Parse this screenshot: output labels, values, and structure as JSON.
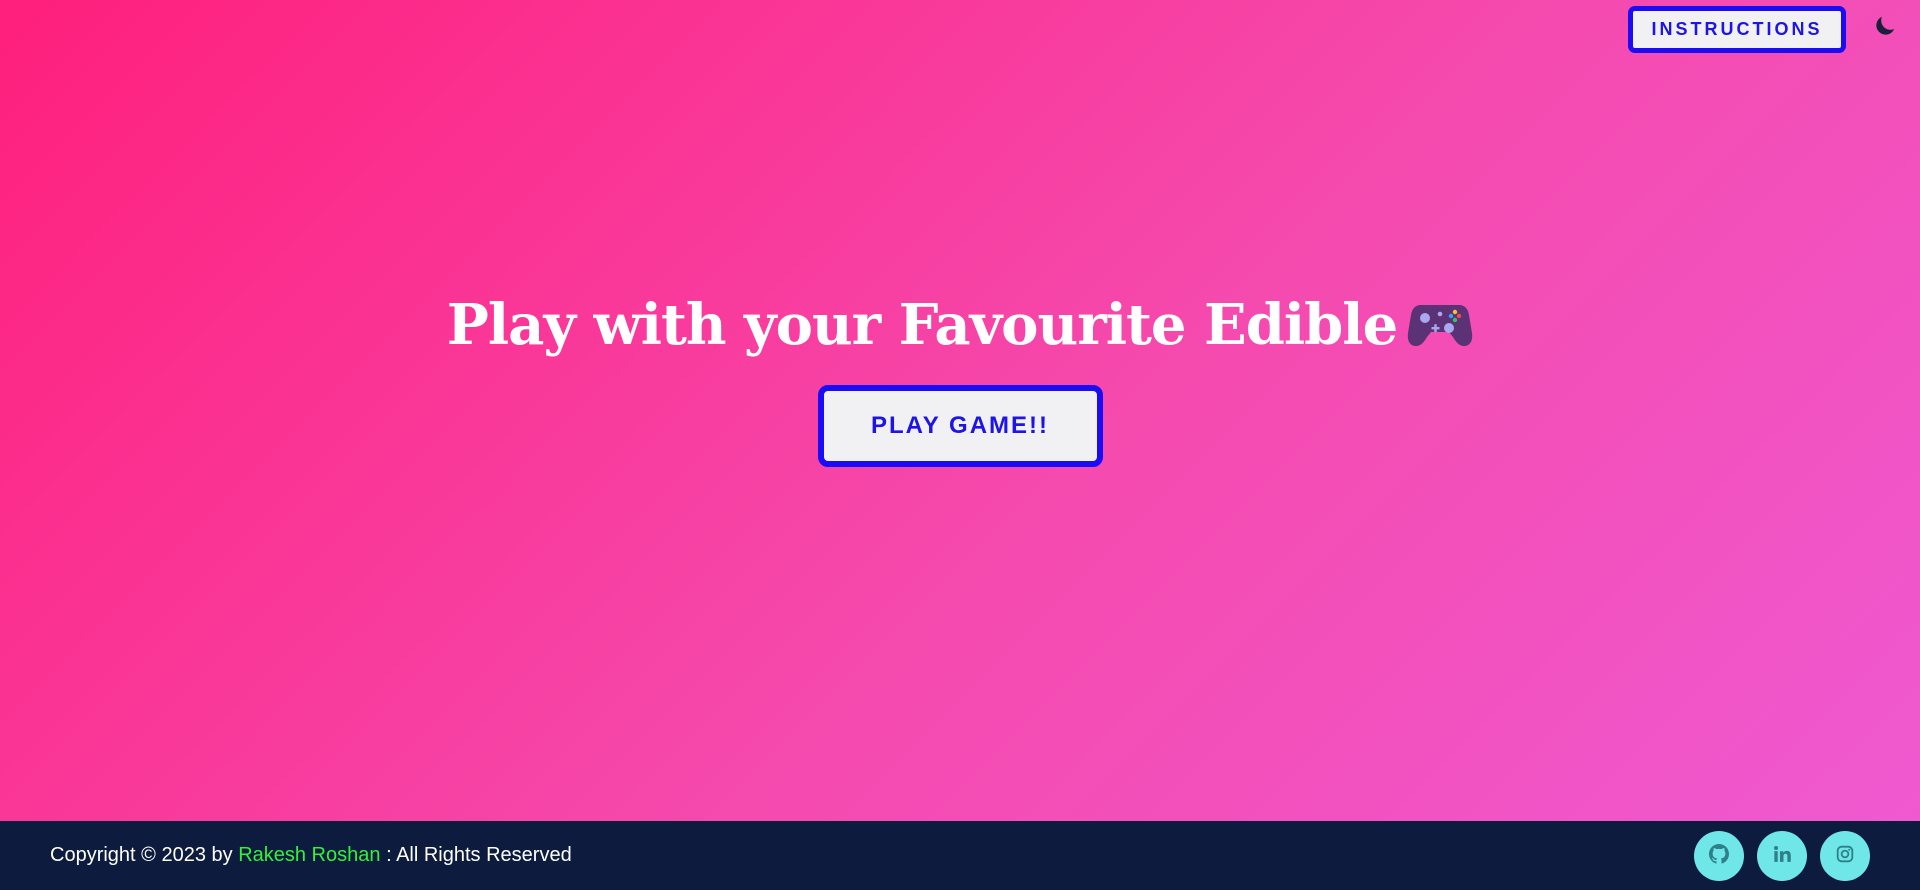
{
  "header": {
    "instructions_label": "INSTRUCTIONS",
    "theme_toggle_icon": "moon-icon"
  },
  "hero": {
    "title": "Play with your Favourite Edible",
    "title_icon": "gamepad-icon",
    "play_button_label": "PLAY GAME!!"
  },
  "footer": {
    "copyright_prefix": "Copyright © 2023 by",
    "author_name": "Rakesh Roshan",
    "copyright_suffix": ": All Rights Reserved",
    "social": [
      {
        "icon": "github-icon"
      },
      {
        "icon": "linkedin-icon"
      },
      {
        "icon": "instagram-icon"
      }
    ]
  },
  "colors": {
    "background_gradient_start": "#ff1f7c",
    "background_gradient_end": "#ef5ad3",
    "button_border": "#1a0cf5",
    "button_text": "#1d14e6",
    "footer_background": "#0c1b3e",
    "author_link": "#2ff23a",
    "social_button": "#6fe6e8"
  }
}
